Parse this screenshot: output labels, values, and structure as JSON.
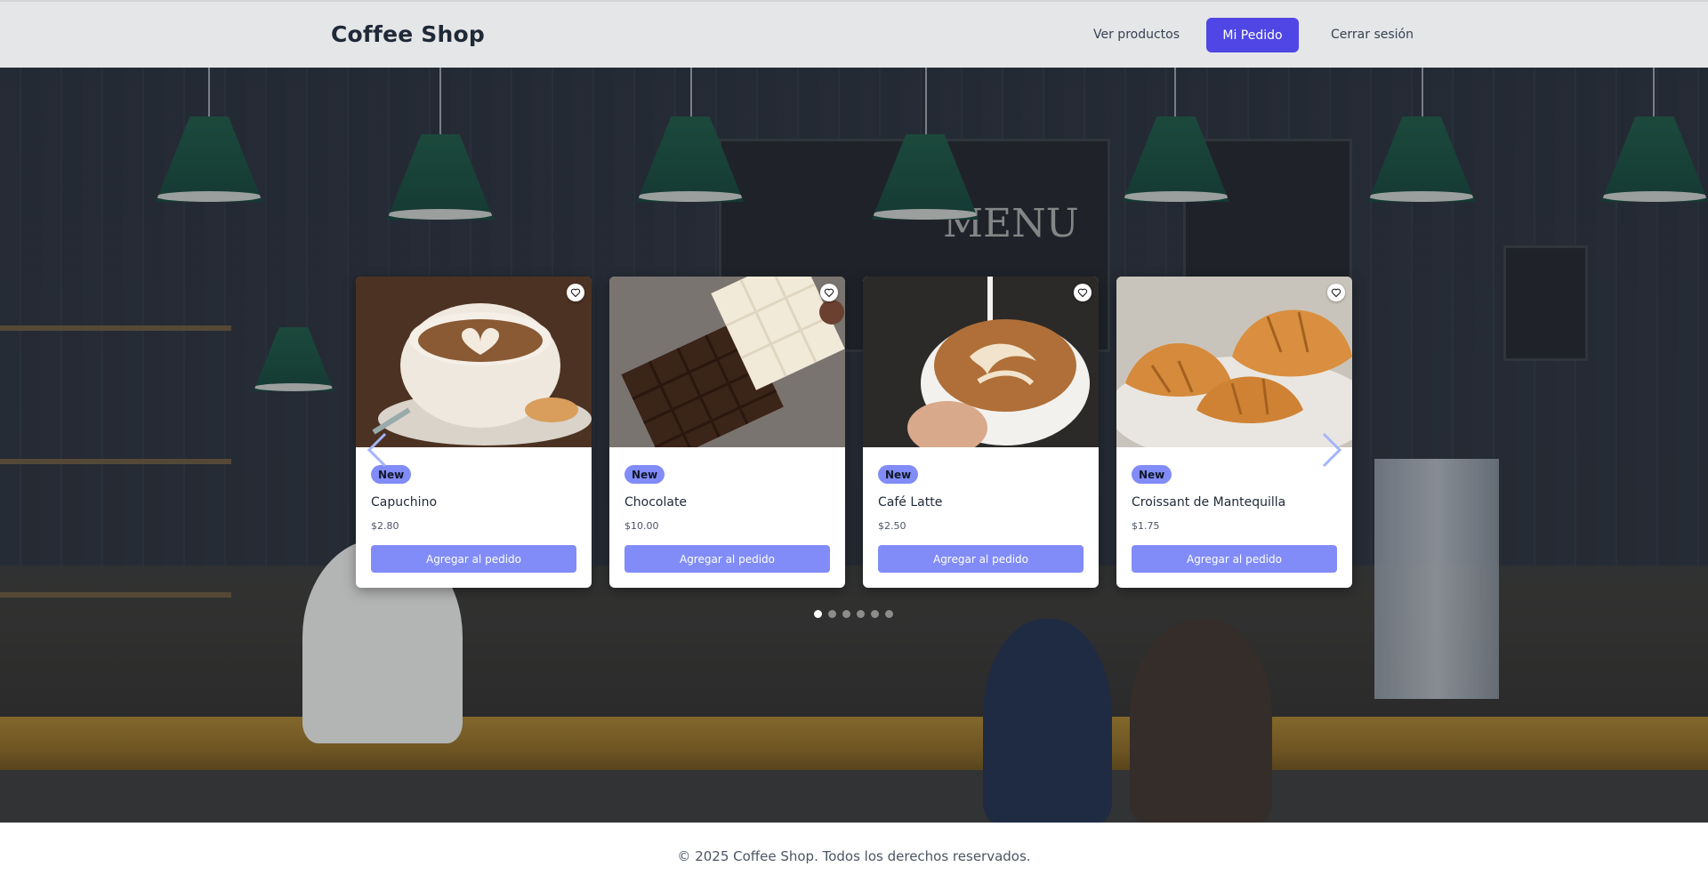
{
  "header": {
    "brand": "Coffee Shop",
    "nav": {
      "products": "Ver productos",
      "order": "Mi Pedido",
      "logout": "Cerrar sesión"
    }
  },
  "carousel": {
    "cards": [
      {
        "badge": "New",
        "name": "Capuchino",
        "price": "$2.80",
        "button": "Agregar al pedido",
        "image": "cappuccino-latte-art"
      },
      {
        "badge": "New",
        "name": "Chocolate",
        "price": "$10.00",
        "button": "Agregar al pedido",
        "image": "chocolate-bars"
      },
      {
        "badge": "New",
        "name": "Café Latte",
        "price": "$2.50",
        "button": "Agregar al pedido",
        "image": "latte-art-pour"
      },
      {
        "badge": "New",
        "name": "Croissant de Mantequilla",
        "price": "$1.75",
        "button": "Agregar al pedido",
        "image": "croissants"
      }
    ],
    "dots": 6,
    "active_dot": 0
  },
  "footer": {
    "text": "© 2025 Coffee Shop. Todos los derechos reservados."
  },
  "colors": {
    "primary": "#4f46e5",
    "button_light": "#818cf8",
    "header_bg": "#e5e6e8"
  }
}
